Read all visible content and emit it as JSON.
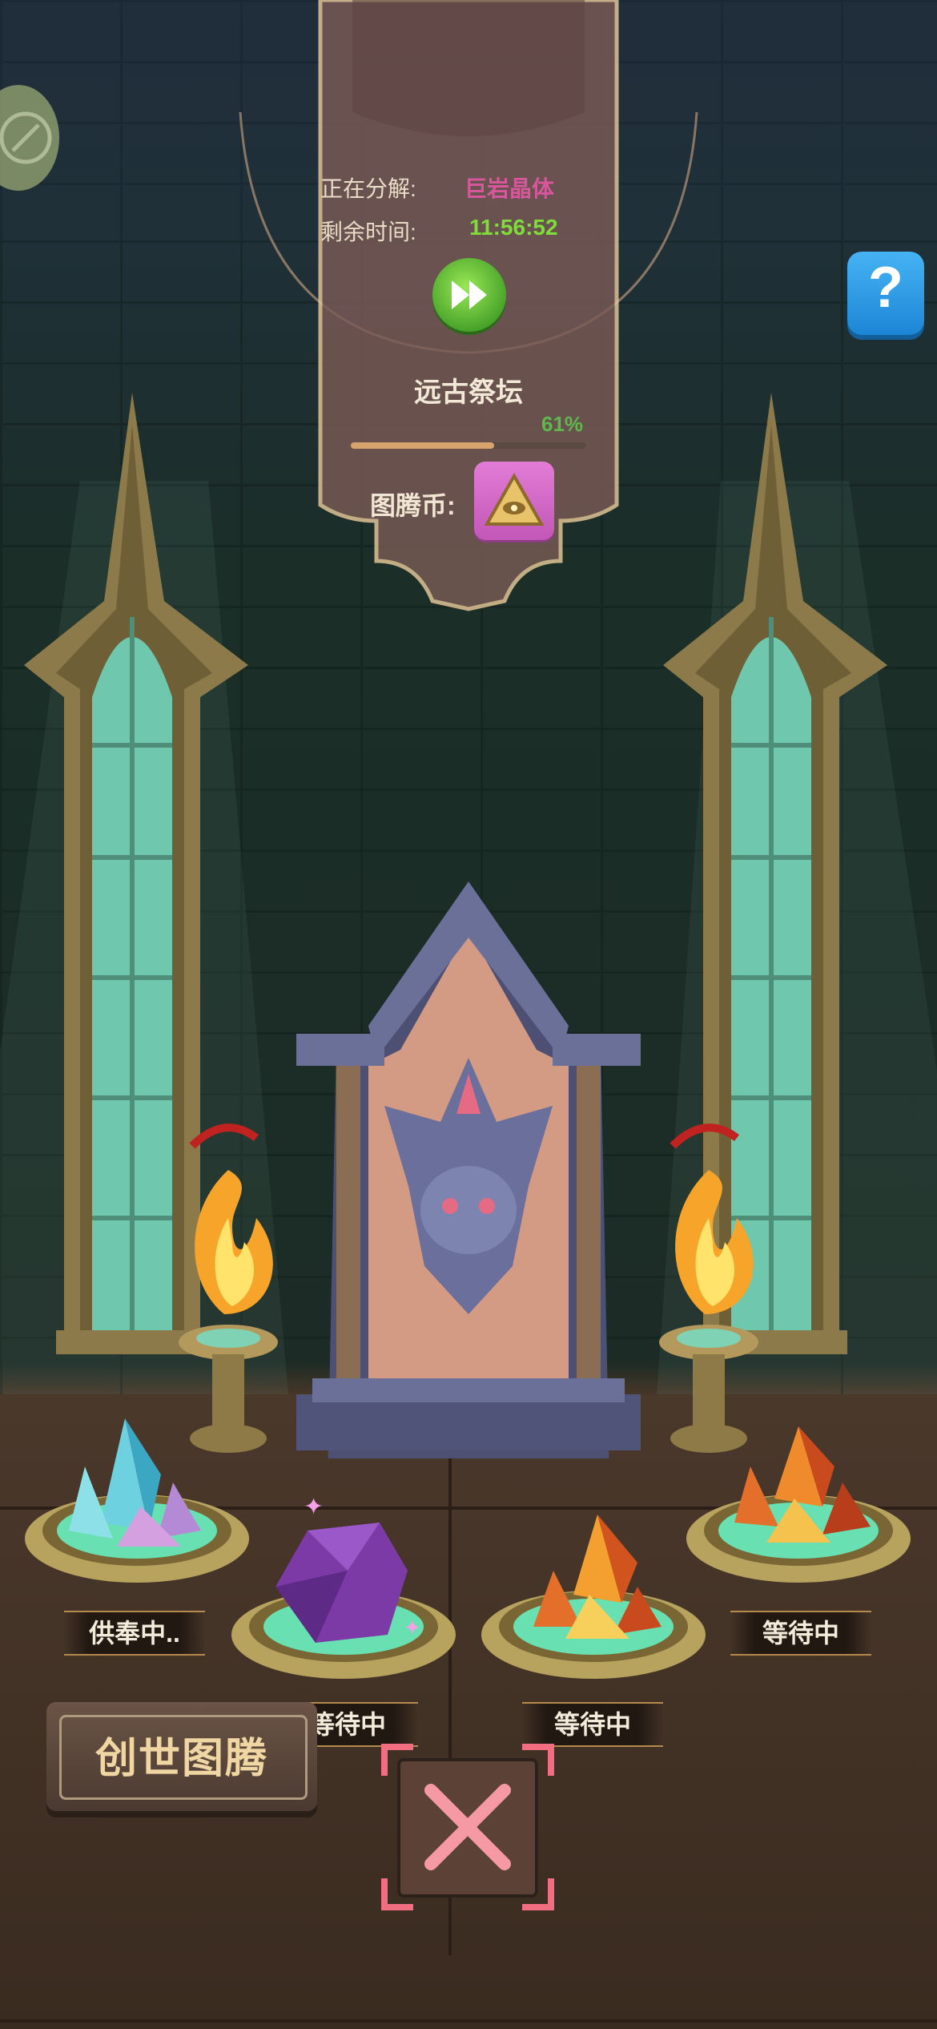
{
  "banner": {
    "decompose_label": "正在分解:",
    "decompose_value": "巨岩晶体",
    "time_label": "剩余时间:",
    "time_value": "11:56:52",
    "altar_title": "远古祭坛",
    "progress_text": "61%",
    "progress": 0.61,
    "coin_label": "图腾币:"
  },
  "help_button": {
    "label": "?"
  },
  "pedestals": [
    {
      "crystal": "cyan-crystal-icon",
      "status": "供奉中.."
    },
    {
      "crystal": "purple-gem-icon",
      "status": "等待中"
    },
    {
      "crystal": "orange-crystal-icon",
      "status": "等待中"
    },
    {
      "crystal": "orange-crystal-icon",
      "status": "等待中"
    }
  ],
  "create_button": {
    "label": "创世图腾"
  },
  "colors": {
    "decompose_value": "#d6579b",
    "time_value": "#7fdc3c",
    "progress_fill": "#d6a46c",
    "help_button": "#2f9be6",
    "close_icon": "#f08a95"
  }
}
